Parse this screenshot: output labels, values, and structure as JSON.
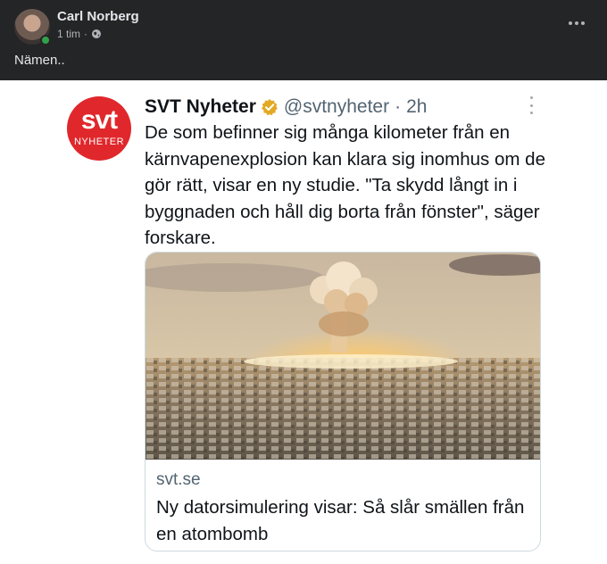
{
  "post": {
    "author": "Carl Norberg",
    "time": "1 tim",
    "separator": "·",
    "privacy_icon": "globe-icon",
    "text": "Nämen.."
  },
  "tweet": {
    "display_name": "SVT Nyheter",
    "handle": "@svtnyheter",
    "dot": "·",
    "time": "2h",
    "logo": {
      "big": "svt",
      "small": "NYHETER"
    },
    "text": "De som befinner sig många kilometer från en kärnvapenexplosion kan klara sig inomhus om de gör rätt, visar en ny studie. \"Ta skydd långt in i byggnaden och håll dig borta från fönster\", säger forskare.",
    "card": {
      "domain": "svt.se",
      "title": "Ny datorsimulering visar: Så slår smällen från en atombomb"
    }
  },
  "colors": {
    "fb_bg": "#242526",
    "svt_red": "#e0272b",
    "verified_gold": "#e2a924",
    "online_green": "#31a24c"
  }
}
